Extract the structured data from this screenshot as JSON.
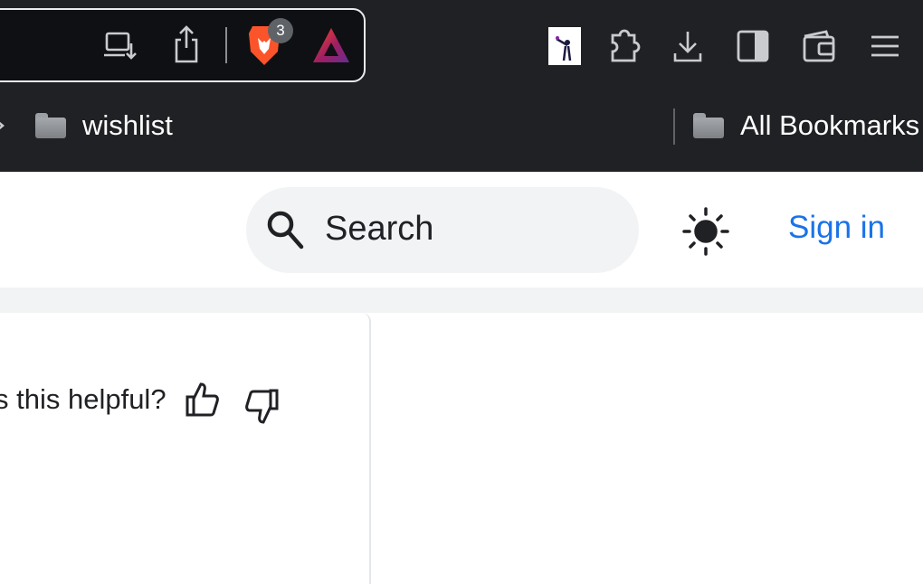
{
  "browser": {
    "toolbar": {
      "shields_badge": "3",
      "icons": [
        "install-app-icon",
        "share-icon",
        "brave-shields-icon",
        "brave-rewards-icon",
        "profile-extension-icon",
        "extensions-puzzle-icon",
        "download-icon",
        "sidebar-icon",
        "wallet-icon",
        "menu-icon"
      ]
    },
    "bookmarks": {
      "items": [
        {
          "label": "wishlist"
        },
        {
          "label": "All Bookmarks"
        }
      ]
    }
  },
  "page": {
    "search": {
      "placeholder": "Search"
    },
    "signin_label": "Sign in",
    "feedback": {
      "question": "s this helpful?"
    }
  },
  "colors": {
    "accent": "#1a73e8",
    "chrome_bg": "#202124",
    "brave_orange": "#fb542b"
  }
}
